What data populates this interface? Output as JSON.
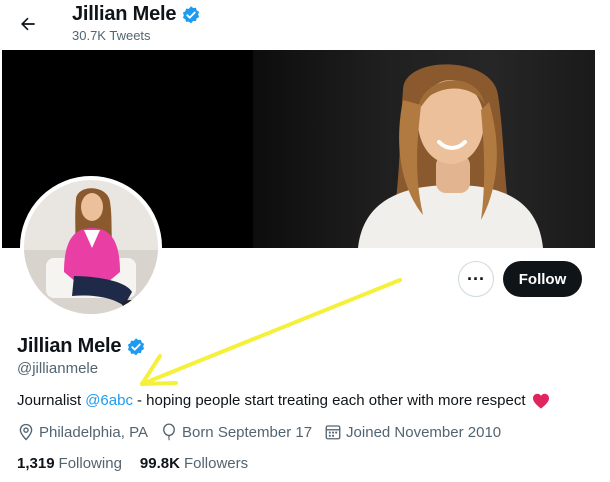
{
  "header": {
    "name": "Jillian Mele",
    "tweet_count": "30.7K Tweets"
  },
  "profile": {
    "name": "Jillian Mele",
    "handle": "@jillianmele",
    "bio_prefix": "Journalist",
    "bio_mention": "@6abc",
    "bio_suffix": "- hoping people start treating each other with more respect",
    "location": "Philadelphia, PA",
    "birthday": "Born September 17",
    "joined": "Joined November 2010",
    "following_count": "1,319",
    "following_label": "Following",
    "followers_count": "99.8K",
    "followers_label": "Followers"
  },
  "actions": {
    "more_label": "···",
    "follow_label": "Follow"
  },
  "icons": {
    "back": "arrow-left-icon",
    "verified": "verified-badge-icon",
    "location": "map-pin-icon",
    "birthday": "balloon-icon",
    "joined": "calendar-icon",
    "heart": "red-heart-icon"
  },
  "colors": {
    "verified_blue": "#1d9bf0",
    "link_blue": "#1d9bf0",
    "follow_button_bg": "#0f1419",
    "muted_text": "#536471",
    "heart_red": "#e0245e",
    "annotation_arrow": "#f5f03a"
  }
}
